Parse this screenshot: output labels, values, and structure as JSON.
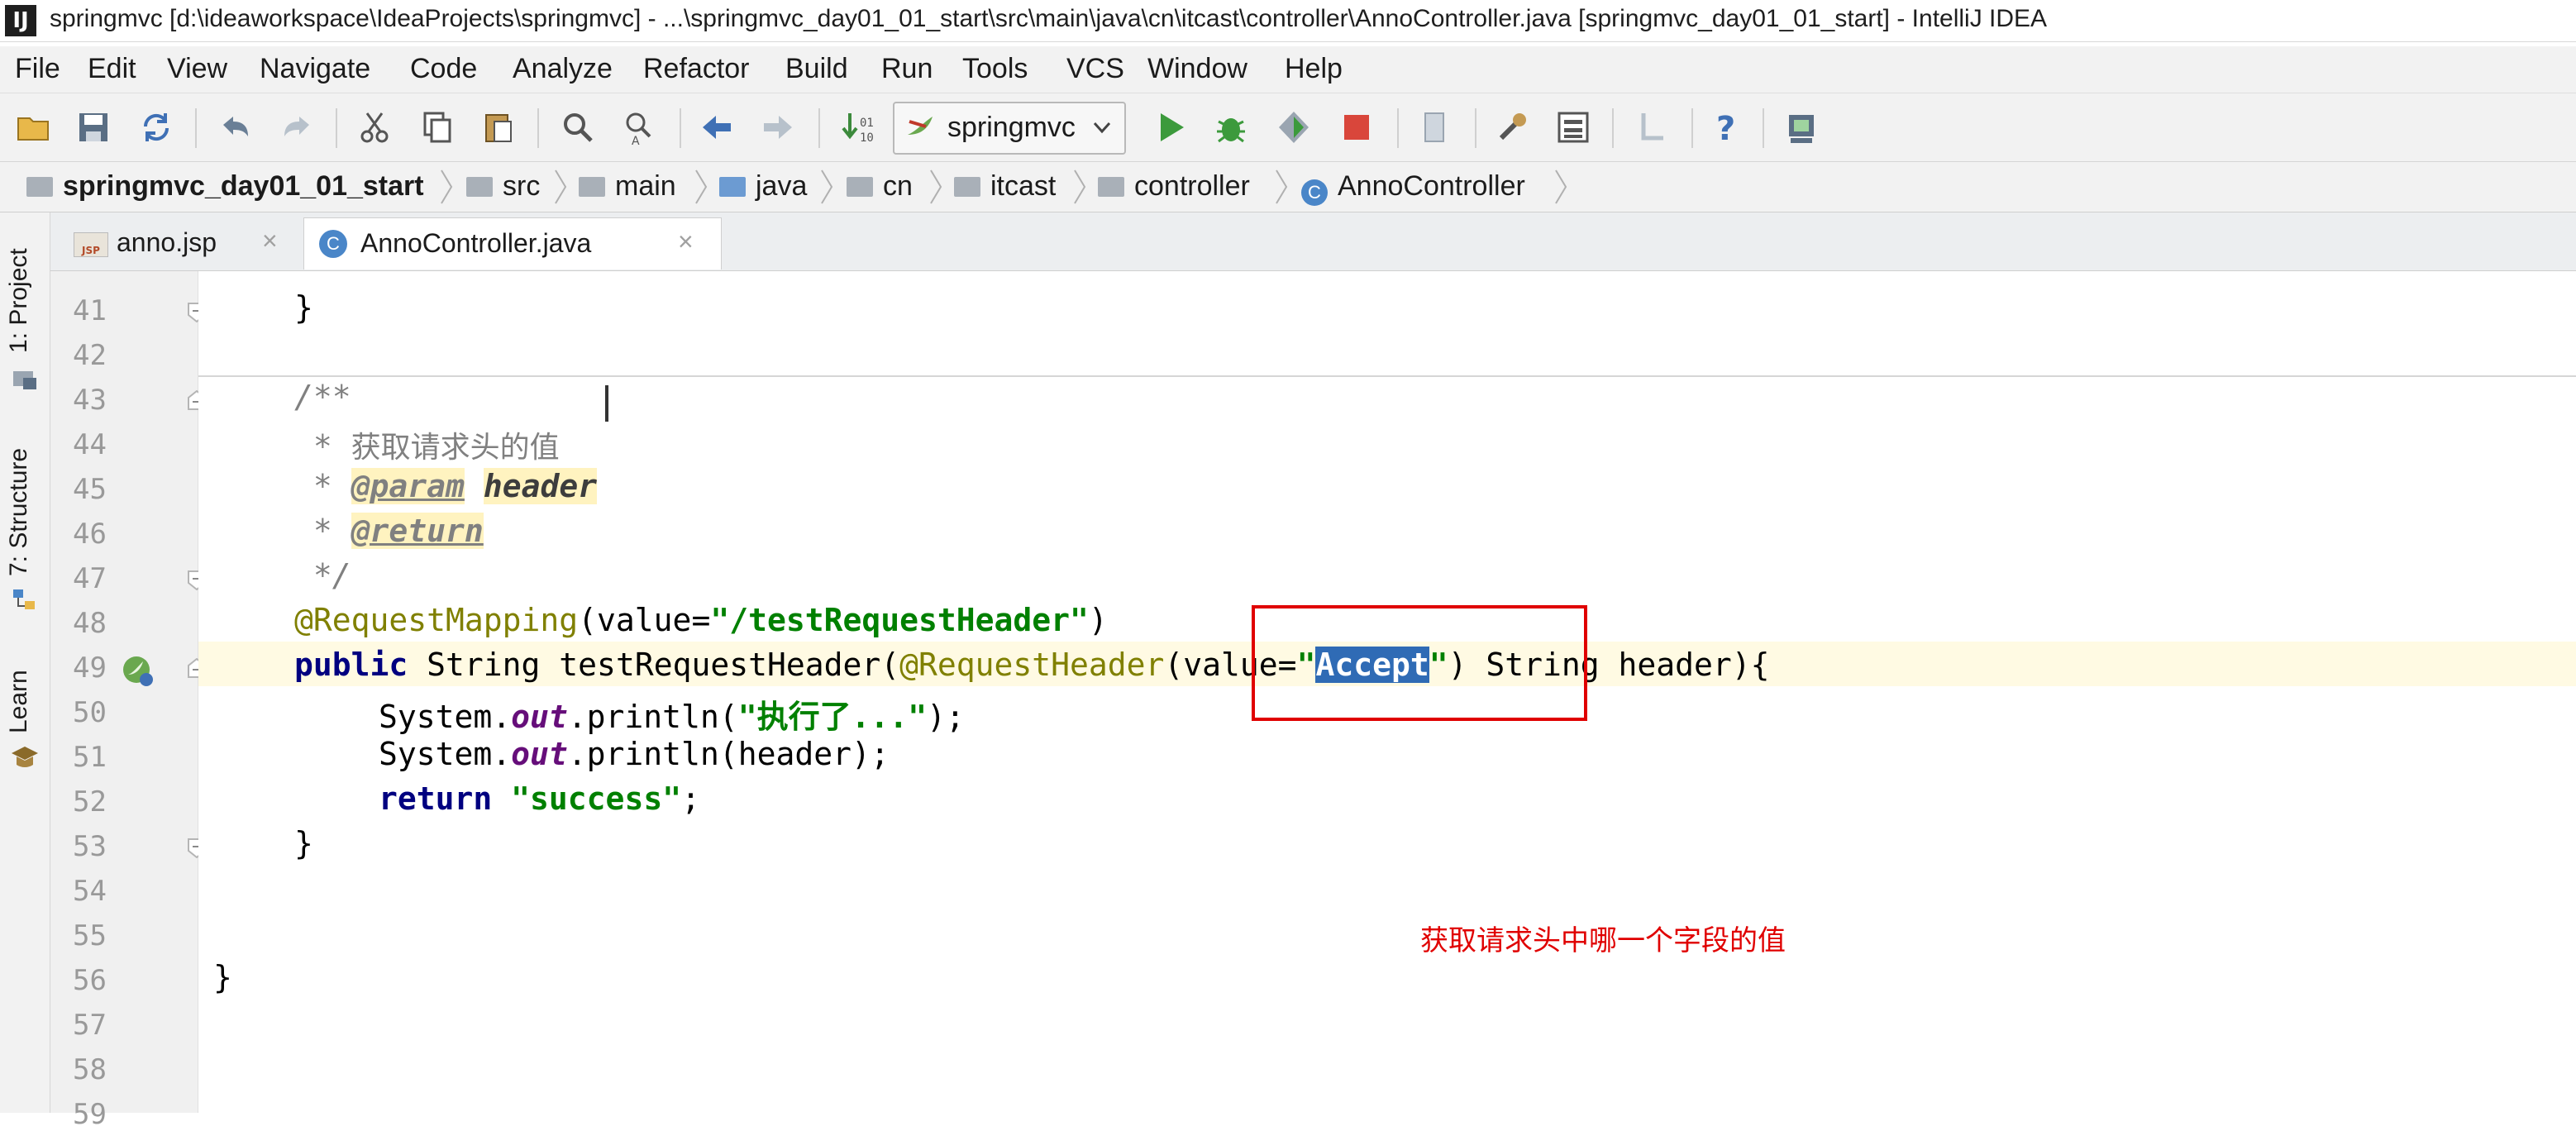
{
  "window": {
    "logo": "IJ",
    "title": "springmvc [d:\\ideaworkspace\\IdeaProjects\\springmvc] - ...\\springmvc_day01_01_start\\src\\main\\java\\cn\\itcast\\controller\\AnnoController.java [springmvc_day01_01_start] - IntelliJ IDEA"
  },
  "menu": [
    "File",
    "Edit",
    "View",
    "Navigate",
    "Code",
    "Analyze",
    "Refactor",
    "Build",
    "Run",
    "Tools",
    "VCS",
    "Window",
    "Help"
  ],
  "toolbar": {
    "run_config": "springmvc",
    "icons": [
      "open-icon",
      "save-icon",
      "sync-icon",
      "undo-icon",
      "redo-icon",
      "cut-icon",
      "copy-icon",
      "paste-icon",
      "find-icon",
      "replace-icon",
      "back-icon",
      "forward-icon",
      "build-icon",
      "run-icon",
      "debug-icon",
      "coverage-icon",
      "stop-icon",
      "attach-icon",
      "settings-icon",
      "project-structure-icon",
      "vcs-icon",
      "help-icon",
      "sdk-icon"
    ]
  },
  "breadcrumb": [
    "springmvc_day01_01_start",
    "src",
    "main",
    "java",
    "cn",
    "itcast",
    "controller",
    "AnnoController"
  ],
  "side_tabs": [
    "1: Project",
    "7: Structure",
    "Learn"
  ],
  "tabs": [
    {
      "icon": "JSP",
      "label": "anno.jsp",
      "active": false
    },
    {
      "icon": "C",
      "label": "AnnoController.java",
      "active": true
    }
  ],
  "editor": {
    "line_numbers": [
      "41",
      "42",
      "43",
      "44",
      "45",
      "46",
      "47",
      "48",
      "49",
      "50",
      "51",
      "52",
      "53",
      "54",
      "55",
      "56",
      "57",
      "58",
      "59"
    ],
    "lines": {
      "l41": "}",
      "l43": "/**",
      "l44a": " * ",
      "l44b": "获取请求头的值",
      "l45a": " * ",
      "l45b": "@param",
      "l45c": "header",
      "l46a": " * ",
      "l46b": "@return",
      "l47": " */",
      "l48a": "@RequestMapping",
      "l48b": "(value=",
      "l48c": "\"/testRequestHeader\"",
      "l48d": ")",
      "l49a": "public",
      "l49b": " String testRequestHeader(",
      "l49c": "@RequestHeader",
      "l49d": "(value=",
      "l49e": "\"",
      "l49f": "Accept",
      "l49g": "\"",
      "l49h": ") String header){",
      "l50a": "System.",
      "l50b": "out",
      "l50c": ".println(",
      "l50d": "\"执行了...\"",
      "l50e": ");",
      "l51a": "System.",
      "l51b": "out",
      "l51c": ".println(header);",
      "l52a": "return",
      "l52b": "\"success\"",
      "l52c": ";",
      "l53": "}",
      "l56": "}"
    },
    "note": "获取请求头中哪一个字段的值"
  },
  "colors": {
    "keyword": "#000080",
    "annotation": "#808000",
    "string": "#008000",
    "comment": "#808080",
    "highlight_box": "#e00000",
    "selection": "#2f6bb5"
  }
}
